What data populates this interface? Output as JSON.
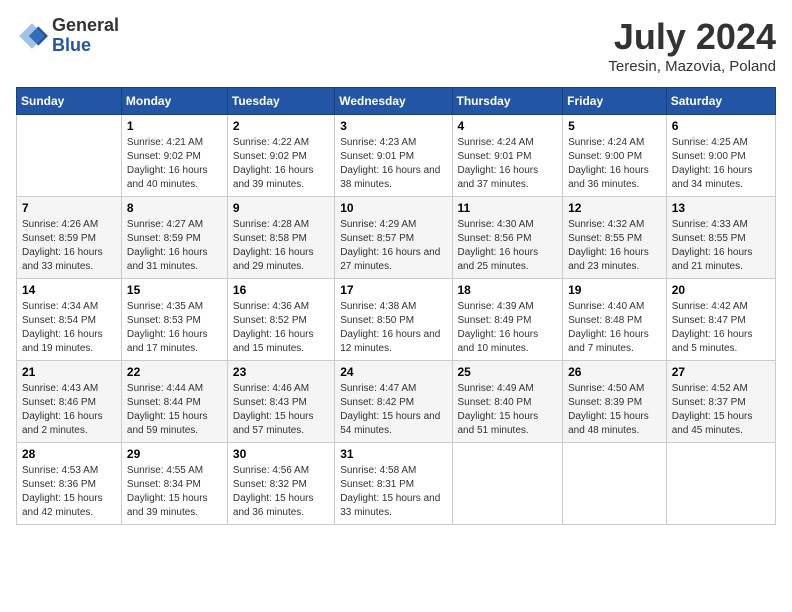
{
  "logo": {
    "general": "General",
    "blue": "Blue"
  },
  "title": "July 2024",
  "location": "Teresin, Mazovia, Poland",
  "days_of_week": [
    "Sunday",
    "Monday",
    "Tuesday",
    "Wednesday",
    "Thursday",
    "Friday",
    "Saturday"
  ],
  "weeks": [
    [
      {
        "day": "",
        "info": ""
      },
      {
        "day": "1",
        "info": "Sunrise: 4:21 AM\nSunset: 9:02 PM\nDaylight: 16 hours and 40 minutes."
      },
      {
        "day": "2",
        "info": "Sunrise: 4:22 AM\nSunset: 9:02 PM\nDaylight: 16 hours and 39 minutes."
      },
      {
        "day": "3",
        "info": "Sunrise: 4:23 AM\nSunset: 9:01 PM\nDaylight: 16 hours and 38 minutes."
      },
      {
        "day": "4",
        "info": "Sunrise: 4:24 AM\nSunset: 9:01 PM\nDaylight: 16 hours and 37 minutes."
      },
      {
        "day": "5",
        "info": "Sunrise: 4:24 AM\nSunset: 9:00 PM\nDaylight: 16 hours and 36 minutes."
      },
      {
        "day": "6",
        "info": "Sunrise: 4:25 AM\nSunset: 9:00 PM\nDaylight: 16 hours and 34 minutes."
      }
    ],
    [
      {
        "day": "7",
        "info": "Sunrise: 4:26 AM\nSunset: 8:59 PM\nDaylight: 16 hours and 33 minutes."
      },
      {
        "day": "8",
        "info": "Sunrise: 4:27 AM\nSunset: 8:59 PM\nDaylight: 16 hours and 31 minutes."
      },
      {
        "day": "9",
        "info": "Sunrise: 4:28 AM\nSunset: 8:58 PM\nDaylight: 16 hours and 29 minutes."
      },
      {
        "day": "10",
        "info": "Sunrise: 4:29 AM\nSunset: 8:57 PM\nDaylight: 16 hours and 27 minutes."
      },
      {
        "day": "11",
        "info": "Sunrise: 4:30 AM\nSunset: 8:56 PM\nDaylight: 16 hours and 25 minutes."
      },
      {
        "day": "12",
        "info": "Sunrise: 4:32 AM\nSunset: 8:55 PM\nDaylight: 16 hours and 23 minutes."
      },
      {
        "day": "13",
        "info": "Sunrise: 4:33 AM\nSunset: 8:55 PM\nDaylight: 16 hours and 21 minutes."
      }
    ],
    [
      {
        "day": "14",
        "info": "Sunrise: 4:34 AM\nSunset: 8:54 PM\nDaylight: 16 hours and 19 minutes."
      },
      {
        "day": "15",
        "info": "Sunrise: 4:35 AM\nSunset: 8:53 PM\nDaylight: 16 hours and 17 minutes."
      },
      {
        "day": "16",
        "info": "Sunrise: 4:36 AM\nSunset: 8:52 PM\nDaylight: 16 hours and 15 minutes."
      },
      {
        "day": "17",
        "info": "Sunrise: 4:38 AM\nSunset: 8:50 PM\nDaylight: 16 hours and 12 minutes."
      },
      {
        "day": "18",
        "info": "Sunrise: 4:39 AM\nSunset: 8:49 PM\nDaylight: 16 hours and 10 minutes."
      },
      {
        "day": "19",
        "info": "Sunrise: 4:40 AM\nSunset: 8:48 PM\nDaylight: 16 hours and 7 minutes."
      },
      {
        "day": "20",
        "info": "Sunrise: 4:42 AM\nSunset: 8:47 PM\nDaylight: 16 hours and 5 minutes."
      }
    ],
    [
      {
        "day": "21",
        "info": "Sunrise: 4:43 AM\nSunset: 8:46 PM\nDaylight: 16 hours and 2 minutes."
      },
      {
        "day": "22",
        "info": "Sunrise: 4:44 AM\nSunset: 8:44 PM\nDaylight: 15 hours and 59 minutes."
      },
      {
        "day": "23",
        "info": "Sunrise: 4:46 AM\nSunset: 8:43 PM\nDaylight: 15 hours and 57 minutes."
      },
      {
        "day": "24",
        "info": "Sunrise: 4:47 AM\nSunset: 8:42 PM\nDaylight: 15 hours and 54 minutes."
      },
      {
        "day": "25",
        "info": "Sunrise: 4:49 AM\nSunset: 8:40 PM\nDaylight: 15 hours and 51 minutes."
      },
      {
        "day": "26",
        "info": "Sunrise: 4:50 AM\nSunset: 8:39 PM\nDaylight: 15 hours and 48 minutes."
      },
      {
        "day": "27",
        "info": "Sunrise: 4:52 AM\nSunset: 8:37 PM\nDaylight: 15 hours and 45 minutes."
      }
    ],
    [
      {
        "day": "28",
        "info": "Sunrise: 4:53 AM\nSunset: 8:36 PM\nDaylight: 15 hours and 42 minutes."
      },
      {
        "day": "29",
        "info": "Sunrise: 4:55 AM\nSunset: 8:34 PM\nDaylight: 15 hours and 39 minutes."
      },
      {
        "day": "30",
        "info": "Sunrise: 4:56 AM\nSunset: 8:32 PM\nDaylight: 15 hours and 36 minutes."
      },
      {
        "day": "31",
        "info": "Sunrise: 4:58 AM\nSunset: 8:31 PM\nDaylight: 15 hours and 33 minutes."
      },
      {
        "day": "",
        "info": ""
      },
      {
        "day": "",
        "info": ""
      },
      {
        "day": "",
        "info": ""
      }
    ]
  ]
}
